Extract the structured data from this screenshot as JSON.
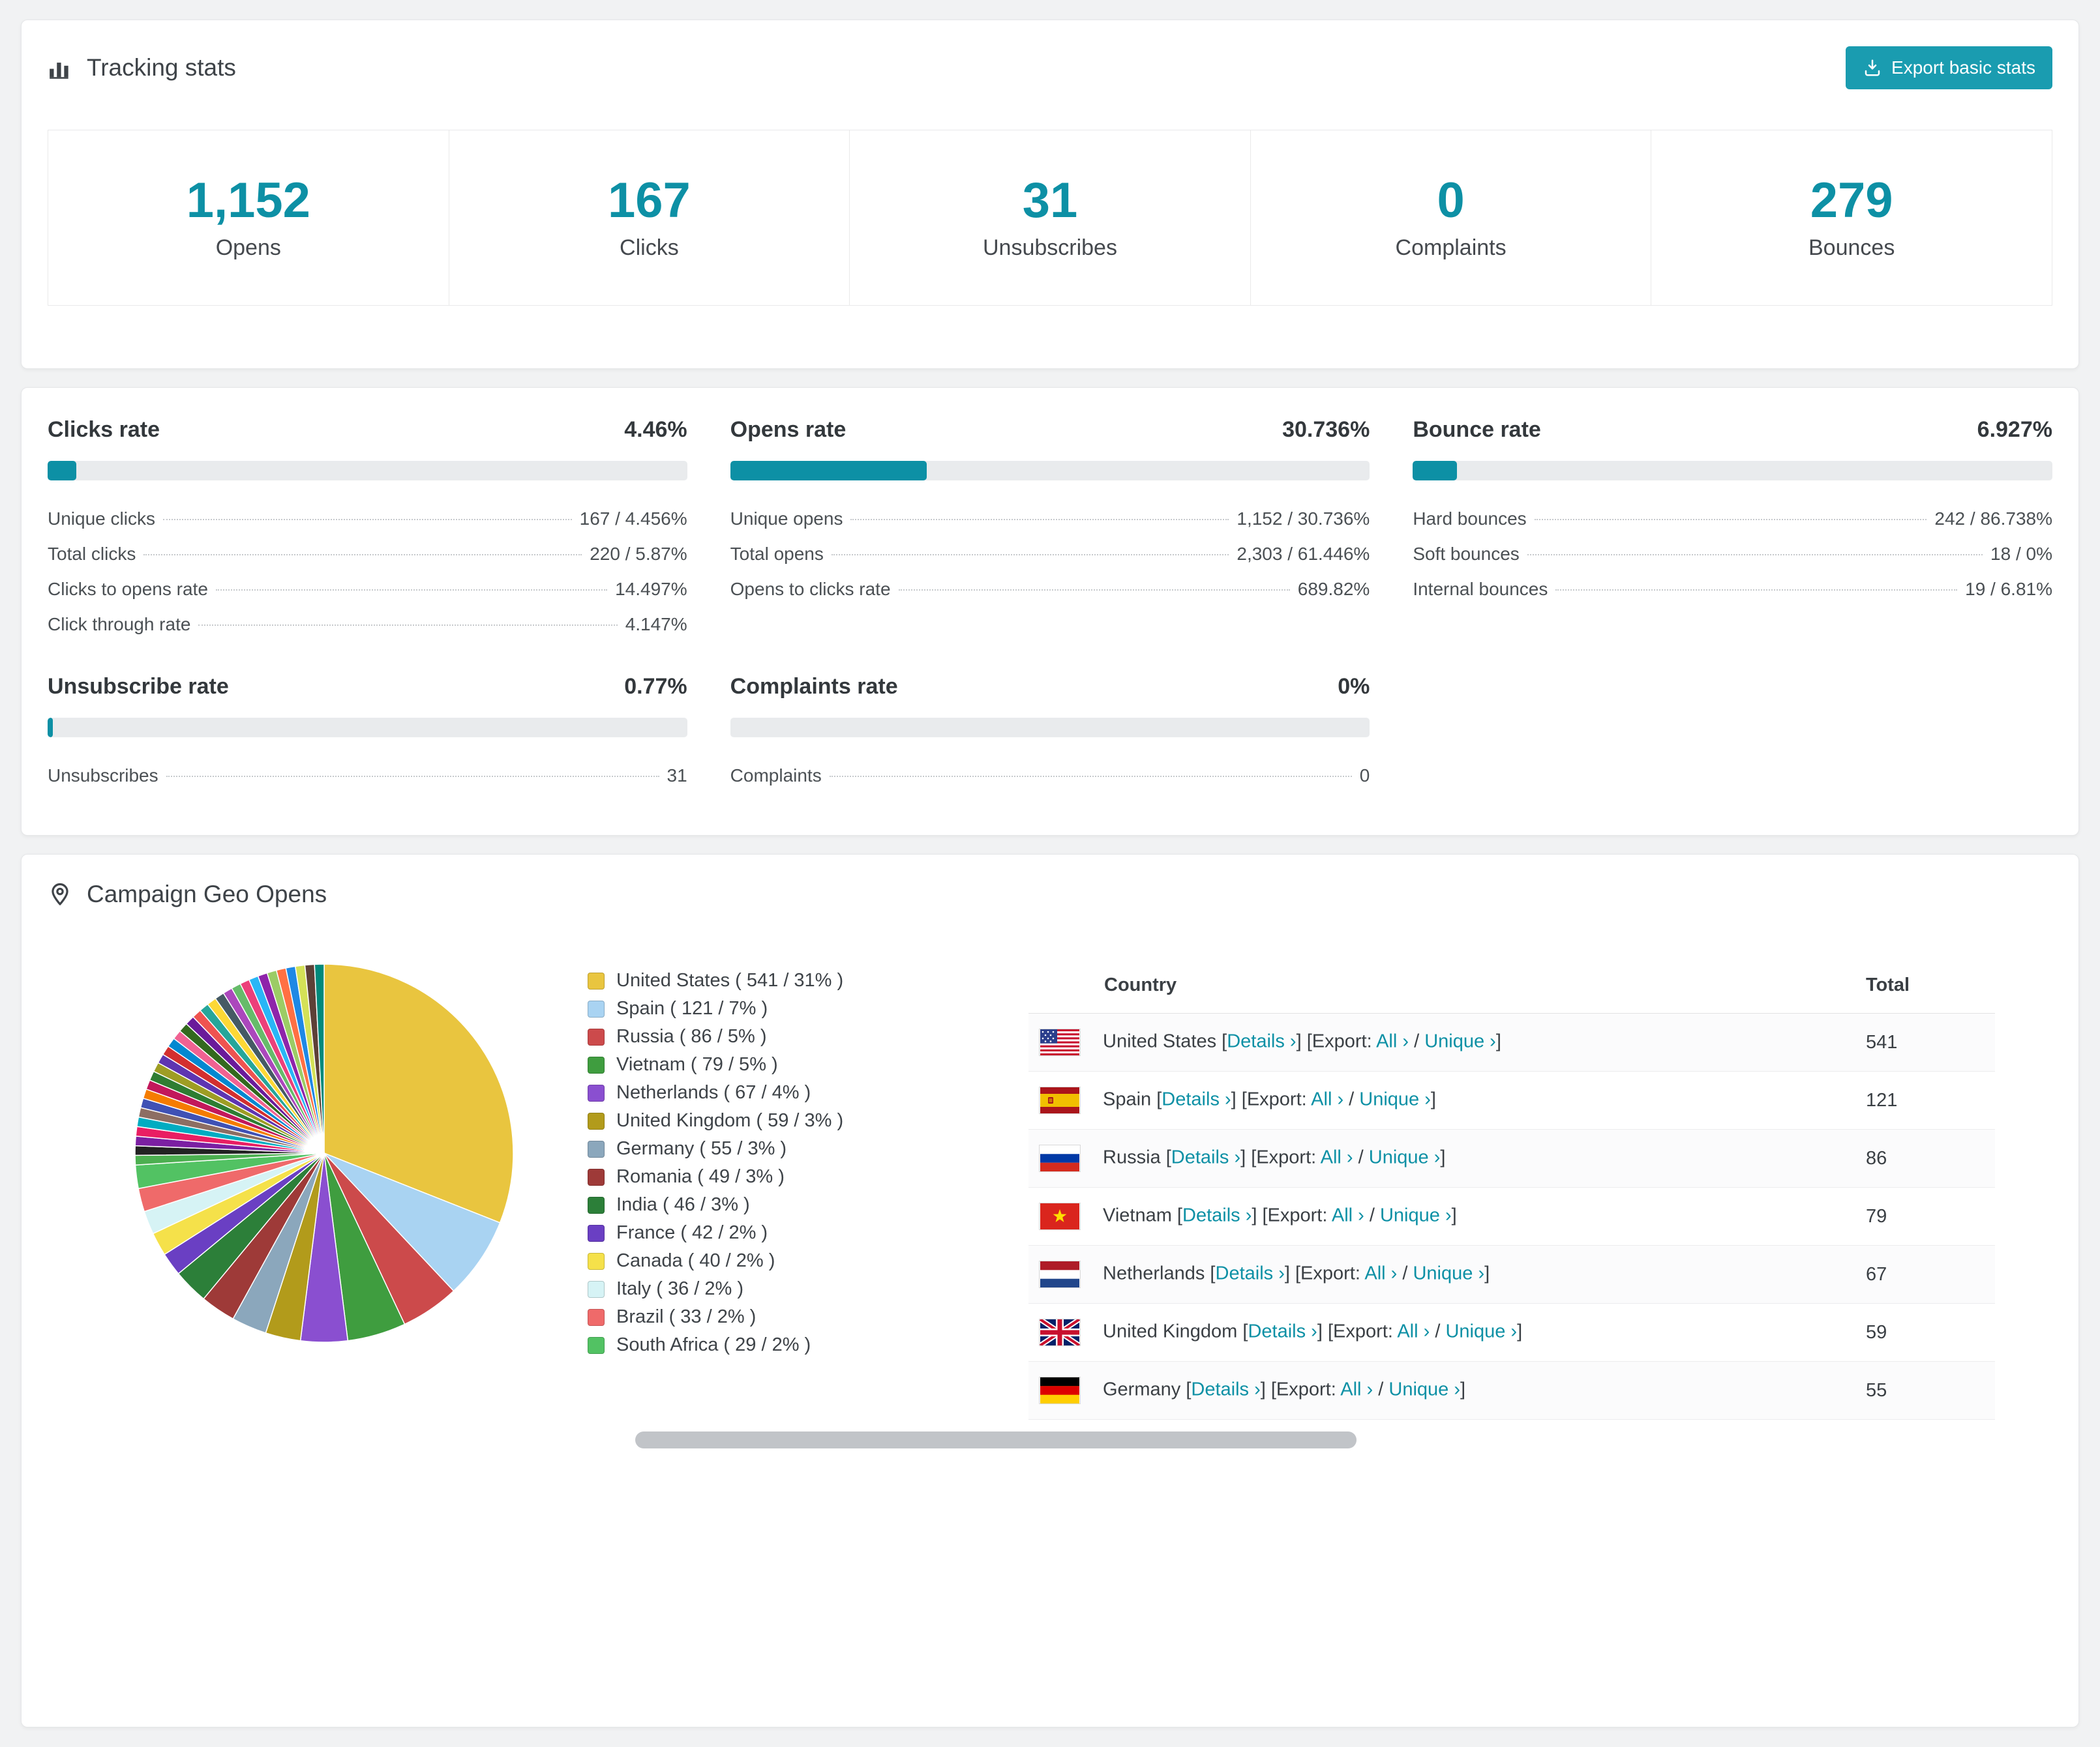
{
  "accent": "#0d90a5",
  "tracking": {
    "title": "Tracking stats",
    "export_button": "Export basic stats",
    "stats": [
      {
        "value": "1,152",
        "label": "Opens"
      },
      {
        "value": "167",
        "label": "Clicks"
      },
      {
        "value": "31",
        "label": "Unsubscribes"
      },
      {
        "value": "0",
        "label": "Complaints"
      },
      {
        "value": "279",
        "label": "Bounces"
      }
    ]
  },
  "rates": [
    {
      "title": "Clicks rate",
      "value": "4.46%",
      "percent": 4.46,
      "rows": [
        {
          "label": "Unique clicks",
          "value": "167 / 4.456%"
        },
        {
          "label": "Total clicks",
          "value": "220 / 5.87%"
        },
        {
          "label": "Clicks to opens rate",
          "value": "14.497%"
        },
        {
          "label": "Click through rate",
          "value": "4.147%"
        }
      ]
    },
    {
      "title": "Opens rate",
      "value": "30.736%",
      "percent": 30.736,
      "rows": [
        {
          "label": "Unique opens",
          "value": "1,152 / 30.736%"
        },
        {
          "label": "Total opens",
          "value": "2,303 / 61.446%"
        },
        {
          "label": "Opens to clicks rate",
          "value": "689.82%"
        }
      ]
    },
    {
      "title": "Bounce rate",
      "value": "6.927%",
      "percent": 6.927,
      "rows": [
        {
          "label": "Hard bounces",
          "value": "242 / 86.738%"
        },
        {
          "label": "Soft bounces",
          "value": "18 / 0%"
        },
        {
          "label": "Internal bounces",
          "value": "19 / 6.81%"
        }
      ]
    },
    {
      "title": "Unsubscribe rate",
      "value": "0.77%",
      "percent": 0.77,
      "rows": [
        {
          "label": "Unsubscribes",
          "value": "31"
        }
      ]
    },
    {
      "title": "Complaints rate",
      "value": "0%",
      "percent": 0,
      "rows": [
        {
          "label": "Complaints",
          "value": "0"
        }
      ]
    }
  ],
  "geo": {
    "title": "Campaign Geo Opens",
    "chart_data": {
      "type": "pie",
      "title": "Campaign Geo Opens",
      "legend_position": "right",
      "slices": [
        {
          "label": "United States",
          "value": 541,
          "percent": 31,
          "color": "#e9c53f"
        },
        {
          "label": "Spain",
          "value": 121,
          "percent": 7,
          "color": "#a9d3f2"
        },
        {
          "label": "Russia",
          "value": 86,
          "percent": 5,
          "color": "#cc4a4b"
        },
        {
          "label": "Vietnam",
          "value": 79,
          "percent": 5,
          "color": "#3f9d3f"
        },
        {
          "label": "Netherlands",
          "value": 67,
          "percent": 4,
          "color": "#8a4fd0"
        },
        {
          "label": "United Kingdom",
          "value": 59,
          "percent": 3,
          "color": "#b29b1b"
        },
        {
          "label": "Germany",
          "value": 55,
          "percent": 3,
          "color": "#8ba7bc"
        },
        {
          "label": "Romania",
          "value": 49,
          "percent": 3,
          "color": "#9e3a38"
        },
        {
          "label": "India",
          "value": 46,
          "percent": 3,
          "color": "#2c7f39"
        },
        {
          "label": "France",
          "value": 42,
          "percent": 2,
          "color": "#6a3fc3"
        },
        {
          "label": "Canada",
          "value": 40,
          "percent": 2,
          "color": "#f5e14a"
        },
        {
          "label": "Italy",
          "value": 36,
          "percent": 2,
          "color": "#d6f3f5"
        },
        {
          "label": "Brazil",
          "value": 33,
          "percent": 2,
          "color": "#ef6a6a"
        },
        {
          "label": "South Africa",
          "value": 29,
          "percent": 2,
          "color": "#52c263"
        }
      ],
      "other_slices": {
        "count": 32,
        "total_percent": 26,
        "palette": [
          "#4caf50",
          "#222222",
          "#7b1fa2",
          "#e91e63",
          "#00acc1",
          "#8d6e63",
          "#3f51b5",
          "#f57c00",
          "#c2185b",
          "#2e7d32",
          "#9e9d24",
          "#5e35b1",
          "#d32f2f",
          "#0288d1",
          "#f06292",
          "#33691e",
          "#6a1b9a",
          "#ef5350",
          "#26a69a",
          "#fdd835",
          "#455a64",
          "#ab47bc",
          "#66bb6a",
          "#ec407a",
          "#29b6f6",
          "#8e24aa",
          "#9ccc65",
          "#ff7043",
          "#1e88e5",
          "#d4e157",
          "#5d4037",
          "#00897b"
        ]
      }
    },
    "table": {
      "headers": [
        "Country",
        "Total"
      ],
      "details_label": "Details ›",
      "export_label": "Export:",
      "all_label": "All ›",
      "unique_label": "Unique ›",
      "rows": [
        {
          "country": "United States",
          "code": "us",
          "total": "541"
        },
        {
          "country": "Spain",
          "code": "es",
          "total": "121"
        },
        {
          "country": "Russia",
          "code": "ru",
          "total": "86"
        },
        {
          "country": "Vietnam",
          "code": "vn",
          "total": "79"
        },
        {
          "country": "Netherlands",
          "code": "nl",
          "total": "67"
        },
        {
          "country": "United Kingdom",
          "code": "gb",
          "total": "59"
        },
        {
          "country": "Germany",
          "code": "de",
          "total": "55"
        }
      ]
    }
  }
}
